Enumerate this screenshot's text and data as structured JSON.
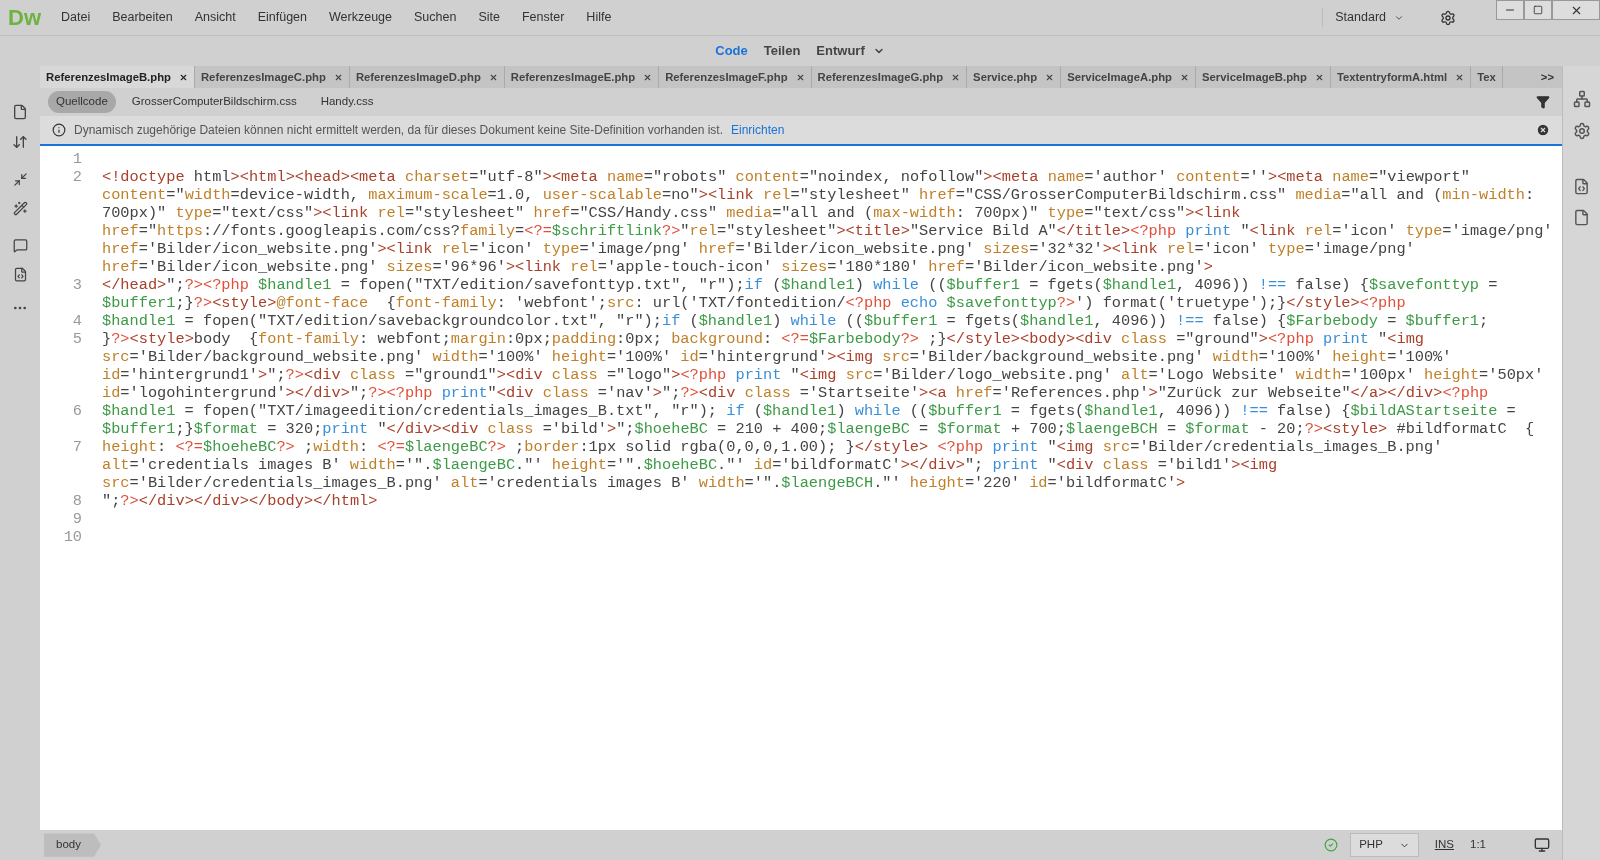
{
  "app": {
    "logo": "Dw"
  },
  "menu": [
    "Datei",
    "Bearbeiten",
    "Ansicht",
    "Einfügen",
    "Werkzeuge",
    "Suchen",
    "Site",
    "Fenster",
    "Hilfe"
  ],
  "workspace": {
    "label": "Standard"
  },
  "view_switcher": [
    {
      "label": "Code",
      "selected": true
    },
    {
      "label": "Teilen",
      "selected": false
    },
    {
      "label": "Entwurf",
      "selected": false
    }
  ],
  "document_tabs": [
    {
      "label": "ReferenzesImageB.php",
      "selected": true,
      "closable": true
    },
    {
      "label": "ReferenzesImageC.php",
      "selected": false,
      "closable": true
    },
    {
      "label": "ReferenzesImageD.php",
      "selected": false,
      "closable": true
    },
    {
      "label": "ReferenzesImageE.php",
      "selected": false,
      "closable": true
    },
    {
      "label": "ReferenzesImageF.php",
      "selected": false,
      "closable": true
    },
    {
      "label": "ReferenzesImageG.php",
      "selected": false,
      "closable": true
    },
    {
      "label": "Service.php",
      "selected": false,
      "closable": true
    },
    {
      "label": "ServiceImageA.php",
      "selected": false,
      "closable": true
    },
    {
      "label": "ServiceImageB.php",
      "selected": false,
      "closable": true
    },
    {
      "label": "TextentryformA.html",
      "selected": false,
      "closable": true
    },
    {
      "label": "Tex",
      "selected": false,
      "closable": false
    }
  ],
  "tabs_overflow": ">>",
  "related_files": [
    {
      "label": "Quellcode",
      "selected": true
    },
    {
      "label": "GrosserComputerBildschirm.css",
      "selected": false
    },
    {
      "label": "Handy.css",
      "selected": false
    }
  ],
  "info_bar": {
    "message": "Dynamisch zugehörige Dateien können nicht ermittelt werden, da für dieses Dokument keine Site-Definition vorhanden ist.",
    "link": "Einrichten"
  },
  "editor": {
    "lines": [
      {
        "number": "1"
      },
      {
        "number": "2",
        "rows": [
          "<!doctype html><html><head><meta charset=\"utf-8\"><meta name=\"robots\" content=\"noindex, nofollow\"><meta name='author' content=''><meta name=\"viewport\"",
          "content=\"width=device-width, maximum-scale=1.0, user-scalable=no\"><link rel=\"stylesheet\" href=\"CSS/GrosserComputerBildschirm.css\" media=\"all and (min-width:",
          "700px)\" type=\"text/css\"><link rel=\"stylesheet\" href=\"CSS/Handy.css\" media=\"all and (max-width: 700px)\" type=\"text/css\"><link",
          "href=\"https://fonts.googleapis.com/css?family=<?=$schriftlink?>\"rel=\"stylesheet\"><title>\"Service Bild A\"</title><?php print \"<link rel='icon' type='image/png'",
          "href='Bilder/icon_website.png'><link rel='icon' type='image/png' href='Bilder/icon_website.png' sizes='32*32'><link rel='icon' type='image/png'",
          "href='Bilder/icon_website.png' sizes='96*96'><link rel='apple-touch-icon' sizes='180*180' href='Bilder/icon_website.png'>"
        ]
      },
      {
        "number": "3",
        "rows": [
          "</head>\";?><?php $handle1 = fopen(\"TXT/edition/savefonttyp.txt\", \"r\");if ($handle1) while (($buffer1 = fgets($handle1, 4096)) !== false) {$savefonttyp =",
          "$buffer1;}?><style>@font-face  {font-family: 'webfont';src: url('TXT/fontedition/<?php echo $savefonttyp?>') format('truetype');}</style><?php"
        ]
      },
      {
        "number": "4",
        "rows": [
          "$handle1 = fopen(\"TXT/edition/savebackgroundcolor.txt\", \"r\");if ($handle1) while (($buffer1 = fgets($handle1, 4096)) !== false) {$Farbebody = $buffer1;"
        ]
      },
      {
        "number": "5",
        "rows": [
          "}?><style>body  {font-family: webfont;margin:0px;padding:0px; background: <?=$Farbebody?> ;}</style><body><div class =\"ground\"><?php print \"<img",
          "src='Bilder/background_website.png' width='100%' height='100%' id='hintergrund'><img src='Bilder/background_website.png' width='100%' height='100%'",
          "id='hintergrund1'>\";?><div class =\"ground1\"><div class =\"logo\"><?php print \"<img src='Bilder/logo_website.png' alt='Logo Website' width='100px' height='50px'",
          "id='logohintergrund'></div>\";?><?php print\"<div class ='nav'>\";?><div class ='Startseite'><a href='References.php'>\"Zurück zur Webseite\"</a></div><?php"
        ]
      },
      {
        "number": "6",
        "rows": [
          "$handle1 = fopen(\"TXT/imageedition/credentials_images_B.txt\", \"r\"); if ($handle1) while (($buffer1 = fgets($handle1, 4096)) !== false) {$bildAStartseite =",
          "$buffer1;}$format = 320;print \"</div><div class ='bild'>\";$hoeheBC = 210 + 400;$laengeBC = $format + 700;$laengeBCH = $format - 20;?><style> #bildformatC  {"
        ]
      },
      {
        "number": "7",
        "rows": [
          "height: <?=$hoeheBC?> ;width: <?=$laengeBC?> ;border:1px solid rgba(0,0,0,1.00); }</style> <?php print \"<img src='Bilder/credentials_images_B.png'",
          "alt='credentials images B' width='\".$laengeBC.\"' height='\".$hoeheBC.\"' id='bildformatC'></div>\"; print \"<div class ='bild1'><img",
          "src='Bilder/credentials_images_B.png' alt='credentials images B' width='\".$laengeBCH.\"' height='220' id='bildformatC'>"
        ]
      },
      {
        "number": "8",
        "rows": [
          "\";?></div></div></body></html>"
        ]
      },
      {
        "number": "9"
      },
      {
        "number": "10"
      }
    ]
  },
  "status_bar": {
    "tag": "body",
    "language": "PHP",
    "mode": "INS",
    "position": "1:1"
  }
}
